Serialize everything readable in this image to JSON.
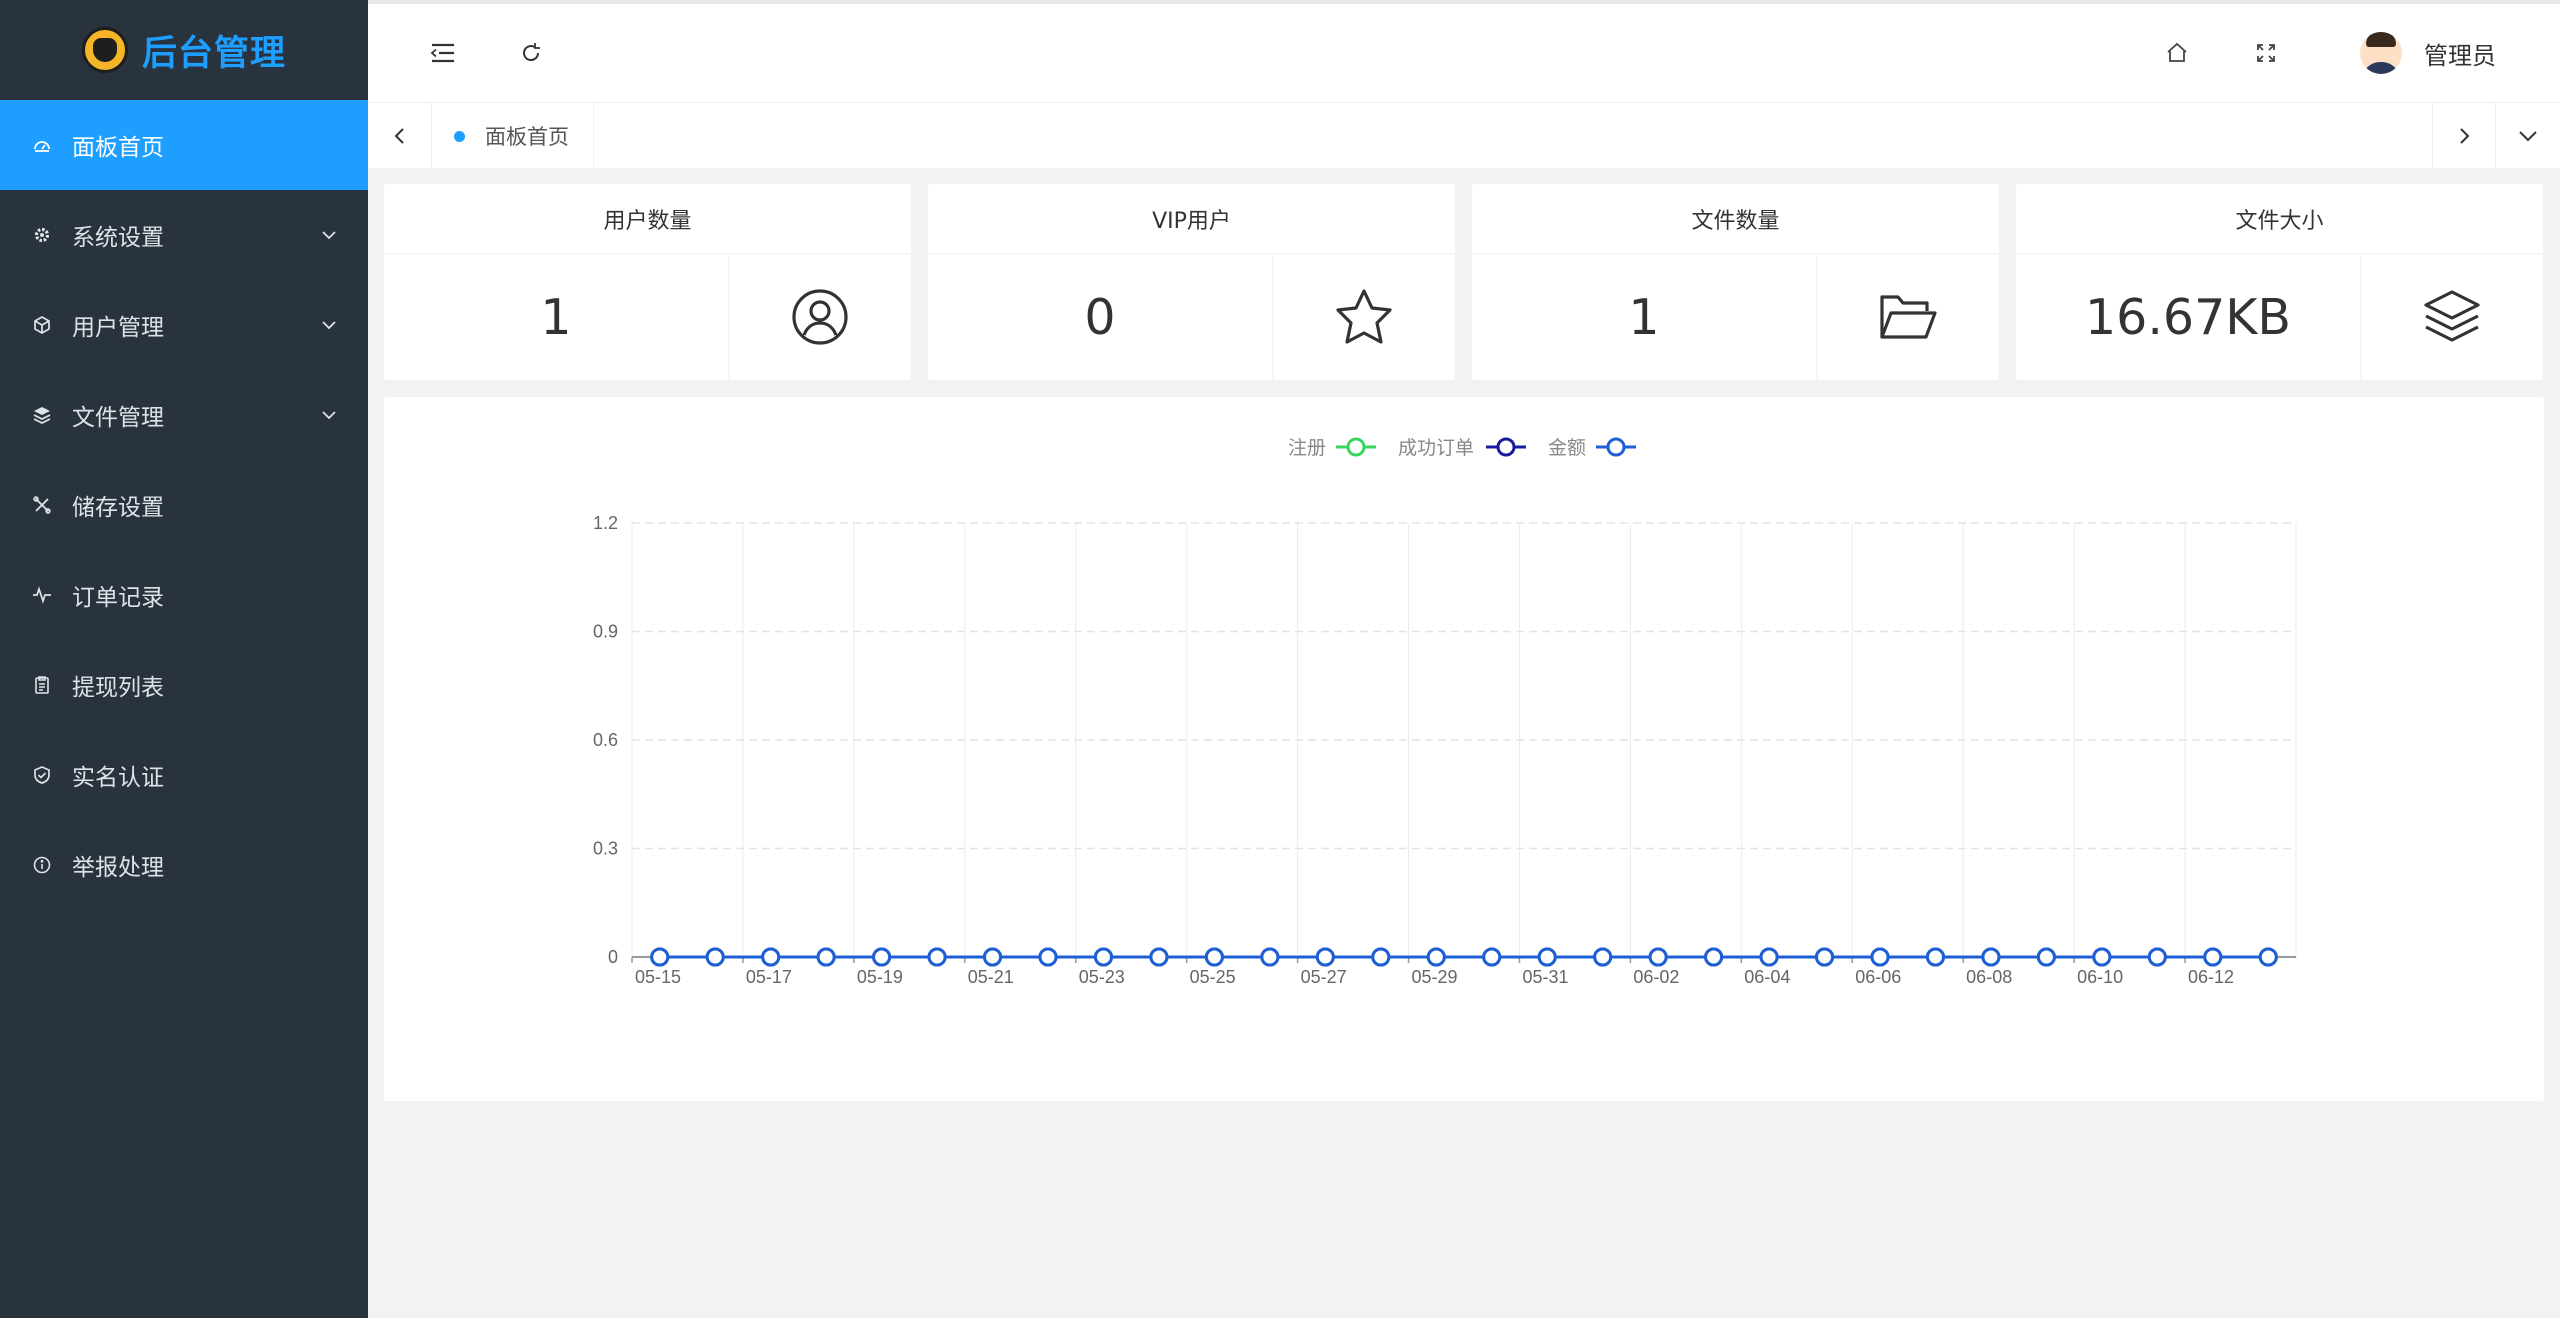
{
  "app": {
    "title": "后台管理"
  },
  "sidebar": {
    "items": [
      {
        "label": "面板首页",
        "icon": "dashboard-icon",
        "active": true,
        "has_children": false
      },
      {
        "label": "系统设置",
        "icon": "gear-icon",
        "active": false,
        "has_children": true
      },
      {
        "label": "用户管理",
        "icon": "cube-icon",
        "active": false,
        "has_children": true
      },
      {
        "label": "文件管理",
        "icon": "layers-icon",
        "active": false,
        "has_children": true
      },
      {
        "label": "储存设置",
        "icon": "tools-icon",
        "active": false,
        "has_children": false
      },
      {
        "label": "订单记录",
        "icon": "pulse-icon",
        "active": false,
        "has_children": false
      },
      {
        "label": "提现列表",
        "icon": "clipboard-icon",
        "active": false,
        "has_children": false
      },
      {
        "label": "实名认证",
        "icon": "shield-check-icon",
        "active": false,
        "has_children": false
      },
      {
        "label": "举报处理",
        "icon": "info-icon",
        "active": false,
        "has_children": false
      }
    ]
  },
  "header": {
    "user_name": "管理员",
    "icons": [
      "menu-indent-icon",
      "refresh-icon",
      "home-icon",
      "fullscreen-icon",
      "avatar"
    ]
  },
  "tabs": [
    {
      "label": "面板首页",
      "active": true
    }
  ],
  "stats": [
    {
      "title": "用户数量",
      "value": "1",
      "icon": "user-circle-icon"
    },
    {
      "title": "VIP用户",
      "value": "0",
      "icon": "star-icon"
    },
    {
      "title": "文件数量",
      "value": "1",
      "icon": "folder-open-icon"
    },
    {
      "title": "文件大小",
      "value": "16.67KB",
      "icon": "layers-icon"
    }
  ],
  "colors": {
    "sidebar_bg": "#28333e",
    "accent": "#1e9fff",
    "series_register": "#3ad65c",
    "series_orders": "#1a1a9e",
    "series_amount": "#1f5fd6"
  },
  "chart_data": {
    "type": "line",
    "x": [
      "05-15",
      "05-16",
      "05-17",
      "05-18",
      "05-19",
      "05-20",
      "05-21",
      "05-22",
      "05-23",
      "05-24",
      "05-25",
      "05-26",
      "05-27",
      "05-28",
      "05-29",
      "05-30",
      "05-31",
      "06-01",
      "06-02",
      "06-03",
      "06-04",
      "06-05",
      "06-06",
      "06-07",
      "06-08",
      "06-09",
      "06-10",
      "06-11",
      "06-12",
      "06-13"
    ],
    "x_tick_labels": [
      "05-15",
      "05-17",
      "05-19",
      "05-21",
      "05-23",
      "05-25",
      "05-27",
      "05-29",
      "05-31",
      "06-02",
      "06-04",
      "06-06",
      "06-08",
      "06-10",
      "06-12"
    ],
    "y_ticks": [
      0,
      0.3,
      0.6,
      0.9,
      1.2
    ],
    "ylim": [
      0,
      1.2
    ],
    "grid": true,
    "legend_position": "top-center",
    "series": [
      {
        "name": "注册",
        "color": "#3ad65c",
        "values": [
          0,
          0,
          0,
          0,
          0,
          0,
          0,
          0,
          0,
          0,
          0,
          0,
          0,
          0,
          0,
          0,
          0,
          0,
          0,
          0,
          0,
          0,
          0,
          0,
          0,
          0,
          0,
          0,
          0,
          0
        ]
      },
      {
        "name": "成功订单",
        "color": "#1a1a9e",
        "values": [
          0,
          0,
          0,
          0,
          0,
          0,
          0,
          0,
          0,
          0,
          0,
          0,
          0,
          0,
          0,
          0,
          0,
          0,
          0,
          0,
          0,
          0,
          0,
          0,
          0,
          0,
          0,
          0,
          0,
          0
        ]
      },
      {
        "name": "金额",
        "color": "#1f5fd6",
        "values": [
          0,
          0,
          0,
          0,
          0,
          0,
          0,
          0,
          0,
          0,
          0,
          0,
          0,
          0,
          0,
          0,
          0,
          0,
          0,
          0,
          0,
          0,
          0,
          0,
          0,
          0,
          0,
          0,
          0,
          0
        ]
      }
    ]
  }
}
